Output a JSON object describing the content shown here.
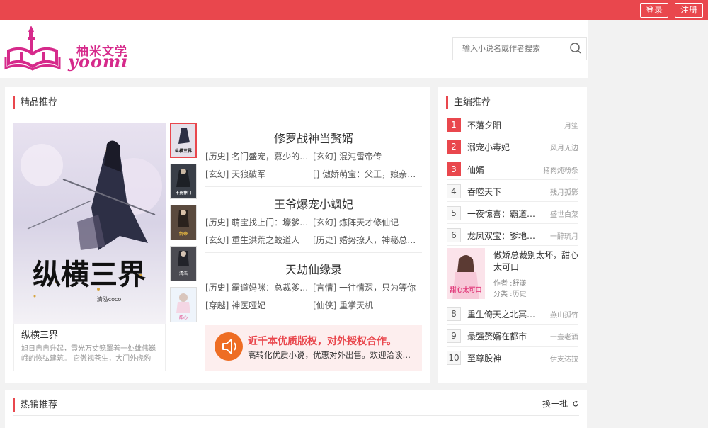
{
  "header": {
    "login_label": "登录",
    "register_label": "注册",
    "logo_text_cn": "柚米文学",
    "logo_text_en": "yoomi",
    "search_placeholder": "输入小说名或作者搜索"
  },
  "colors": {
    "accent": "#e9474d",
    "brand": "#d62a8b",
    "promo_icon": "#ee6d24"
  },
  "featured": {
    "title": "精品推荐",
    "cover_book": {
      "cover_text": "纵横三界",
      "cover_author": "清泓coco",
      "title": "纵横三界",
      "desc": "旭日冉冉升起，霞光万丈笼罩着一处雄伟巍峨的恢弘建筑。 它傲视苍生，大门外虎豹豺狼四大石雕张牙舞爪…"
    },
    "thumbs": [
      "纵横三界",
      "不死神门",
      "剑帝",
      "清浩",
      "甜心"
    ],
    "blocks": [
      {
        "title": "修罗战神当赘婿",
        "links": [
          "[历史] 名门盛宠，慕少的偷…",
          "[玄幻] 混沌雷帝传",
          "[玄幻] 天狼破军",
          "[] 傲娇萌宝：父王，娘亲有药"
        ]
      },
      {
        "title": "王爷爆宠小飒妃",
        "links": [
          "[历史] 萌宝找上门：壕爹妈…",
          "[玄幻] 炼阵天才修仙记",
          "[玄幻] 重生洪荒之蛟道人",
          "[历史] 婚势撩人，神秘总裁…"
        ]
      },
      {
        "title": "天劫仙缘录",
        "links": [
          "[历史] 霸道妈咪：总裁爹地…",
          "[言情] 一往情深，只为等你",
          "[穿越] 神医哑妃",
          "[仙侠] 重掌天机"
        ]
      }
    ],
    "promo": {
      "icon": "speaker-icon",
      "title": "近千本优质版权，对外授权合作。",
      "subtitle": "高转化优质小说，优惠对外出售。欢迎洽谈合作"
    }
  },
  "editor": {
    "title": "主编推荐",
    "items": [
      {
        "rank": "1",
        "title": "不落夕阳",
        "author": "月笙"
      },
      {
        "rank": "2",
        "title": "溺宠小毒妃",
        "author": "风月无边"
      },
      {
        "rank": "3",
        "title": "仙婿",
        "author": "猪肉炖粉条"
      },
      {
        "rank": "4",
        "title": "吞噬天下",
        "author": "残月孤影"
      },
      {
        "rank": "5",
        "title": "一夜惊喜：霸道总裁",
        "author": "盛世白菜"
      },
      {
        "rank": "6",
        "title": "龙凤双宝：爹地宠妻",
        "author": "一醉琉月"
      },
      {
        "rank": "7",
        "title": "傲娇总裁别太坏，甜心太可口",
        "author_label": "作者 :",
        "author": "舒漾",
        "category_label": "分类 :",
        "category": "历史",
        "cover_text": "甜心太可口"
      },
      {
        "rank": "8",
        "title": "重生倚天之北冥神功",
        "author": "燕山孤竹"
      },
      {
        "rank": "9",
        "title": "最强赘婿在都市",
        "author": "一壶老酒"
      },
      {
        "rank": "10",
        "title": "至尊股神",
        "author": "伊支达拉"
      }
    ]
  },
  "hot": {
    "title": "热销推荐",
    "swap_label": "换一批",
    "swap_icon": "refresh-icon"
  }
}
